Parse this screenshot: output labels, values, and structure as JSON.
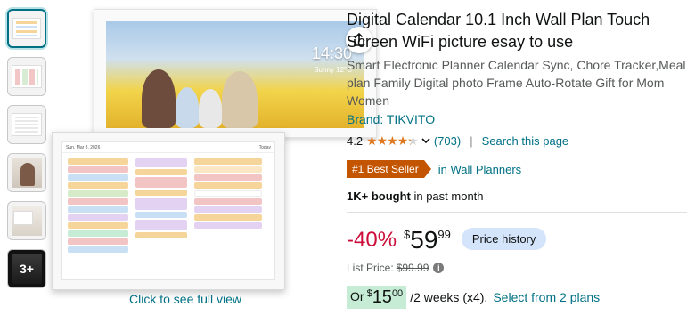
{
  "gallery": {
    "more_thumbs_label": "3+",
    "click_full_view": "Click to see full view",
    "clock_time": "14:30",
    "clock_date": "Sunny 12°C"
  },
  "calendar_screen": {
    "header_date": "Sun, Mar 8, 2026",
    "header_view": "Today"
  },
  "product": {
    "title": "Digital Calendar 10.1 Inch Wall Plan Touch Screen WiFi picture esay to use",
    "subtitle": "Smart Electronic Planner Calendar Sync, Chore Tracker,Meal plan Family Digital photo Frame Auto-Rotate Gift for Mom Women",
    "brand": "Brand: TIKVITO",
    "rating": "4.2",
    "stars_icon": "star-rating-icon",
    "review_count": "(703)",
    "search_this_page": "Search this page",
    "best_seller_badge": "#1 Best Seller",
    "best_seller_category": "in Wall Planners",
    "bought_bold": "1K+ bought",
    "bought_rest": " in past month"
  },
  "pricing": {
    "discount": "-40%",
    "currency": "$",
    "price_whole": "59",
    "price_fraction": "99",
    "price_history_label": "Price history",
    "list_price_label": "List Price:",
    "list_price_value": "$99.99",
    "plan_or": "Or",
    "plan_currency": "$",
    "plan_whole": "15",
    "plan_fraction": "00",
    "plan_term": "/2 weeks (x4).",
    "plan_link": "Select from 2 plans"
  },
  "colors": {
    "link": "#007185",
    "discount": "#cc0c39",
    "best_seller": "#c45500",
    "star": "#de7921"
  }
}
